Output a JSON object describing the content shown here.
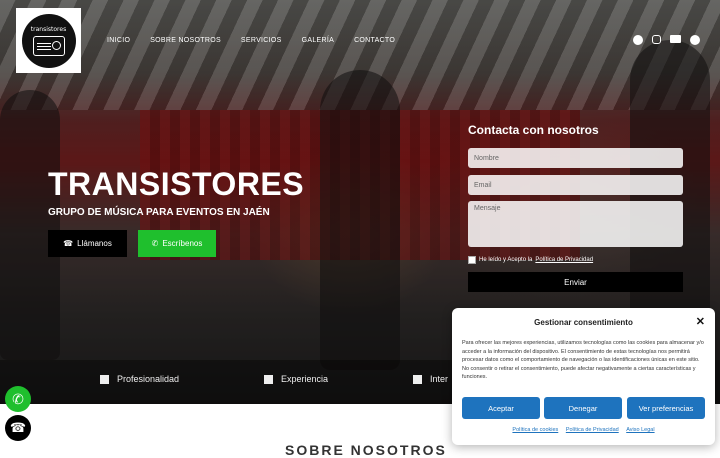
{
  "logo": {
    "text": "transistores"
  },
  "nav": {
    "items": [
      "INICIO",
      "SOBRE NOSOTROS",
      "SERVICIOS",
      "GALERÍA",
      "CONTACTO"
    ]
  },
  "social": {
    "icons": [
      "facebook-icon",
      "instagram-icon",
      "mail-icon",
      "globe-icon"
    ]
  },
  "hero": {
    "title": "TRANSISTORES",
    "subtitle": "GRUPO DE MÚSICA PARA EVENTOS EN JAÉN",
    "call_label": "Llámanos",
    "whatsapp_label": "Escríbenos"
  },
  "contact_form": {
    "title": "Contacta con nosotros",
    "name_placeholder": "Nombre",
    "email_placeholder": "Email",
    "message_placeholder": "Mensaje",
    "privacy_text": "He leído y Acepto la",
    "privacy_link": "Política de Privacidad",
    "send_label": "Enviar"
  },
  "features": [
    "Profesionalidad",
    "Experiencia",
    "Inter"
  ],
  "section_peek": "SOBRE NOSOTROS",
  "cookie": {
    "title": "Gestionar consentimiento",
    "body": "Para ofrecer las mejores experiencias, utilizamos tecnologías como las cookies para almacenar y/o acceder a la información del dispositivo. El consentimiento de estas tecnologías nos permitirá procesar datos como el comportamiento de navegación o las identificaciones únicas en este sitio. No consentir o retirar el consentimiento, puede afectar negativamente a ciertas características y funciones.",
    "accept": "Aceptar",
    "deny": "Denegar",
    "prefs": "Ver preferencias",
    "links": [
      "Política de cookies",
      "Política de Privacidad",
      "Aviso Legal"
    ]
  },
  "colors": {
    "whatsapp": "#1fbf2d",
    "cookie_button": "#1e73be"
  }
}
